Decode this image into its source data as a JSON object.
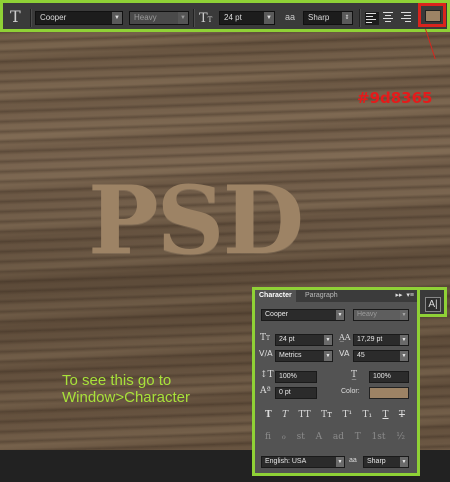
{
  "options_bar": {
    "tool_icon": "T",
    "font_family": "Cooper",
    "font_style": "Heavy",
    "font_size": "24 pt",
    "aa_icon_text": "aa",
    "antialias": "Sharp",
    "text_color": "#9d8365"
  },
  "canvas": {
    "text": "PSD",
    "color_callout": "#9d8365",
    "hint_line1": "To see this go to",
    "hint_line2": "Window>Character"
  },
  "character_panel": {
    "tabs": [
      "Character",
      "Paragraph"
    ],
    "collapse_icon": "▸▸",
    "menu_icon": "▾≡",
    "font_family": "Cooper",
    "font_style": "Heavy",
    "font_size": "24 pt",
    "leading": "17,29 pt",
    "kerning": "Metrics",
    "tracking": "45",
    "vertical_scale": "100%",
    "horizontal_scale": "100%",
    "baseline_shift": "0 pt",
    "color_label": "Color:",
    "color": "#9d8365",
    "style_buttons": [
      "T",
      "T",
      "TT",
      "Tт",
      "T¹",
      "T₁",
      "T",
      "T"
    ],
    "opentype_buttons": [
      "fi",
      "ℴ",
      "st",
      "A",
      "ad",
      "T",
      "1st",
      "½"
    ],
    "language": "English: USA",
    "aa_icon_text": "aa",
    "antialias": "Sharp"
  },
  "panel_toggle_label": "A|"
}
